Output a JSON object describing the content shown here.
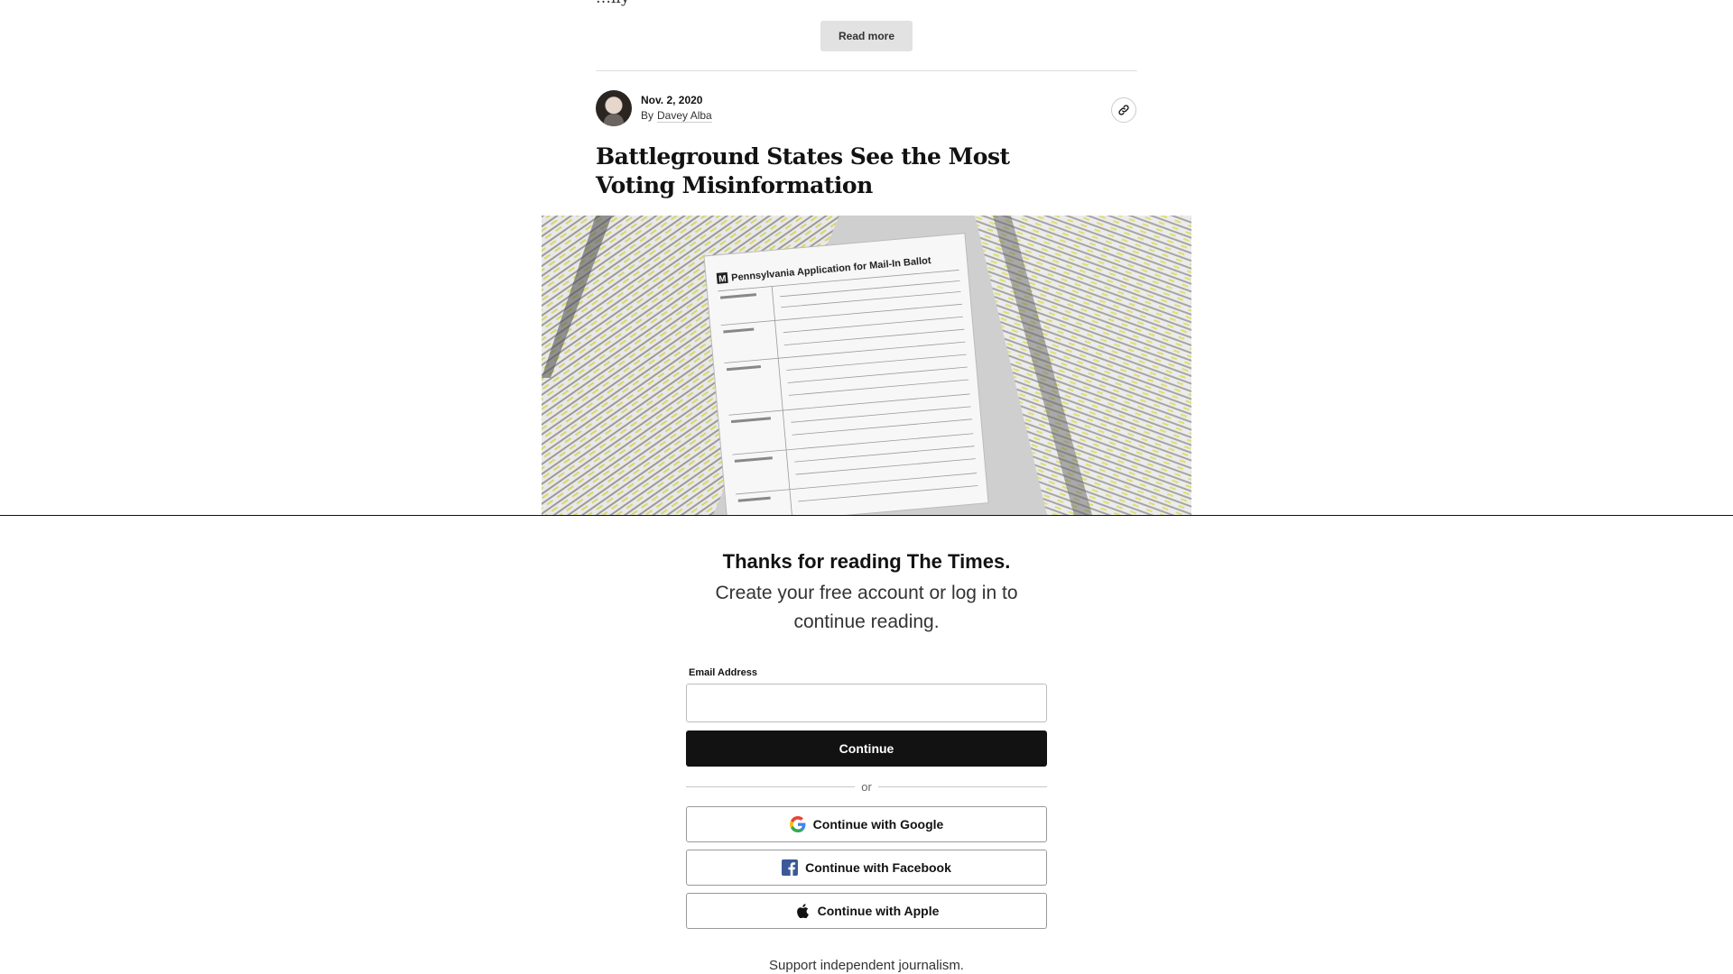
{
  "article": {
    "truncated_text": "…lly",
    "read_more_label": "Read more",
    "date": "Nov. 2, 2020",
    "by_label": "By",
    "author": "Davey Alba",
    "headline": "Battleground States See the Most Voting Misinformation",
    "photo_form_title": "Pennsylvania Application for Mail-In Ballot",
    "photo_form_logo": "M"
  },
  "gate": {
    "title": "Thanks for reading The Times.",
    "subtitle": "Create your free account or log in to continue reading.",
    "email_label": "Email Address",
    "email_value": "",
    "continue_label": "Continue",
    "or_label": "or",
    "google_label": "Continue with Google",
    "facebook_label": "Continue with Facebook",
    "apple_label": "Continue with Apple",
    "support_text": "Support independent journalism."
  },
  "icons": {
    "link": "link-icon",
    "google": "google-logo-icon",
    "facebook": "facebook-logo-icon",
    "apple": "apple-logo-icon"
  },
  "colors": {
    "primary_button": "#121212",
    "facebook_blue": "#3b5998"
  }
}
